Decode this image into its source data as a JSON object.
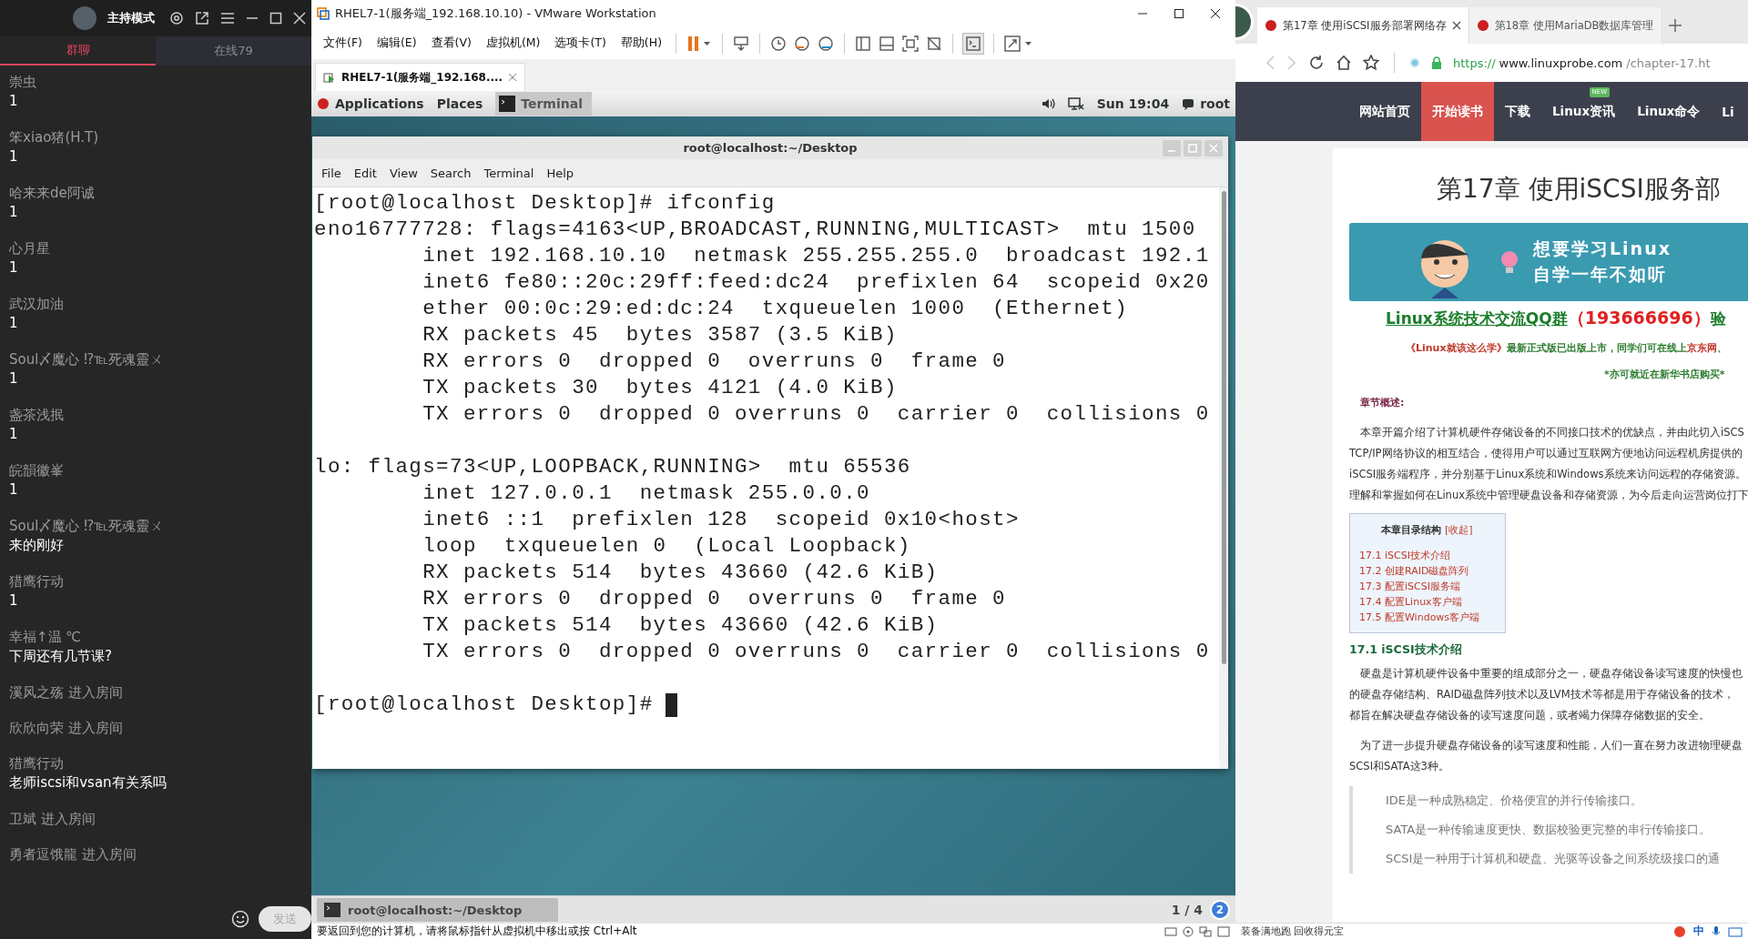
{
  "chat_panel": {
    "host_mode": "主持模式",
    "tabs": [
      {
        "label": "群聊",
        "selected": true
      },
      {
        "label": "在线79",
        "selected": false
      }
    ],
    "messages": [
      {
        "kind": "message",
        "sender": "崇虫",
        "text": "1"
      },
      {
        "kind": "message",
        "sender": "笨xiao猪(H.T)",
        "text": "1"
      },
      {
        "kind": "message",
        "sender": "哈来来de阿诚",
        "text": "1"
      },
      {
        "kind": "message",
        "sender": "心月星",
        "text": "1"
      },
      {
        "kind": "message",
        "sender": "武汉加油",
        "text": "1"
      },
      {
        "kind": "message",
        "sender": "Soul〆魔心 ⁉℡死魂靈ㄨ",
        "text": "1"
      },
      {
        "kind": "message",
        "sender": "盏茶浅抿",
        "text": "1"
      },
      {
        "kind": "message",
        "sender": "皖韻徽峯",
        "text": "1"
      },
      {
        "kind": "message",
        "sender": "Soul〆魔心 ⁉℡死魂靈ㄨ",
        "text": "来的刚好"
      },
      {
        "kind": "message",
        "sender": "猎鹰行动",
        "text": "1"
      },
      {
        "kind": "message",
        "sender": "幸福↑温 ℃",
        "text": "下周还有几节课?"
      },
      {
        "kind": "join",
        "text": "溪风之殇 进入房间"
      },
      {
        "kind": "join",
        "text": "欣欣向荣 进入房间"
      },
      {
        "kind": "message",
        "sender": "猎鹰行动",
        "text": "老师iscsi和vsan有关系吗"
      },
      {
        "kind": "join",
        "text": "卫斌 进入房间"
      },
      {
        "kind": "join",
        "text": "勇者逗饿龍 进入房间"
      }
    ],
    "send_button": "发送"
  },
  "vmware": {
    "title": "RHEL7-1(服务端_192.168.10.10) - VMware Workstation",
    "menu": [
      "文件(F)",
      "编辑(E)",
      "查看(V)",
      "虚拟机(M)",
      "选项卡(T)",
      "帮助(H)"
    ],
    "vm_tab": "RHEL7-1(服务端_192.168....",
    "gnome_bar": {
      "applications": "Applications",
      "places": "Places",
      "active_app": "Terminal",
      "clock": "Sun 19:04",
      "user": "root"
    },
    "terminal": {
      "title": "root@localhost:~/Desktop",
      "menu": [
        "File",
        "Edit",
        "View",
        "Search",
        "Terminal",
        "Help"
      ],
      "blocks": [
        [
          "[root@localhost Desktop]# ifconfig",
          "eno16777728: flags=4163<UP,BROADCAST,RUNNING,MULTICAST>  mtu 1500",
          "        inet 192.168.10.10  netmask 255.255.255.0  broadcast 192.1",
          "        inet6 fe80::20c:29ff:feed:dc24  prefixlen 64  scopeid 0x20",
          "        ether 00:0c:29:ed:dc:24  txqueuelen 1000  (Ethernet)",
          "        RX packets 45  bytes 3587 (3.5 KiB)",
          "        RX errors 0  dropped 0  overruns 0  frame 0",
          "        TX packets 30  bytes 4121 (4.0 KiB)",
          "        TX errors 0  dropped 0 overruns 0  carrier 0  collisions 0"
        ],
        [
          "lo: flags=73<UP,LOOPBACK,RUNNING>  mtu 65536",
          "        inet 127.0.0.1  netmask 255.0.0.0",
          "        inet6 ::1  prefixlen 128  scopeid 0x10<host>",
          "        loop  txqueuelen 0  (Local Loopback)",
          "        RX packets 514  bytes 43660 (42.6 KiB)",
          "        RX errors 0  dropped 0  overruns 0  frame 0",
          "        TX packets 514  bytes 43660 (42.6 KiB)",
          "        TX errors 0  dropped 0 overruns 0  carrier 0  collisions 0"
        ]
      ],
      "prompt": "[root@localhost Desktop]#"
    },
    "taskbar": {
      "window": "root@localhost:~/Desktop",
      "workspace": "1 / 4",
      "notifications": "2"
    },
    "status_bar": "要返回到您的计算机，请将鼠标指针从虚拟机中移出或按 Ctrl+Alt"
  },
  "browser": {
    "tabs": [
      {
        "title": "第17章 使用iSCSI服务部署网络存",
        "selected": true
      },
      {
        "title": "第18章 使用MariaDB数据库管理",
        "selected": false
      }
    ],
    "url": {
      "scheme": "https://",
      "host": "www.linuxprobe.com",
      "path": "/chapter-17.ht"
    },
    "nav": [
      {
        "label": "网站首页",
        "selected": false
      },
      {
        "label": "开始读书",
        "selected": true
      },
      {
        "label": "下载",
        "selected": false
      },
      {
        "label": "Linux资讯",
        "selected": false,
        "badge": "NEW"
      },
      {
        "label": "Linux命令",
        "selected": false
      },
      {
        "label": "Li",
        "selected": false
      }
    ],
    "article": {
      "title": "第17章 使用iSCSI服务部",
      "banner": [
        "想要学习Linux",
        "自学一年不如听"
      ],
      "qq_group": {
        "label": "Linux系统技术交流QQ群",
        "number": "（193666696）",
        "tail": "验"
      },
      "book_notice": [
        {
          "text": "《Linux就该这么学》",
          "kind": "highlight"
        },
        {
          "text": "最新正式版已出版上市，同学们可在线上",
          "kind": "plain"
        },
        {
          "text": "京东网",
          "kind": "highlight"
        },
        {
          "text": "、",
          "kind": "plain"
        }
      ],
      "bookstore_notice": "*亦可就近在新华书店购买*",
      "summary_label": "章节概述:",
      "summary_lines": [
        "本章开篇介绍了计算机硬件存储设备的不同接口技术的优缺点，并由此切入iSCS",
        "TCP/IP网络协议的相互结合，使得用户可以通过互联网方便地访问远程机房提供的",
        "iSCSI服务端程序，并分别基于Linux系统和Windows系统来访问远程的存储资源。",
        "理解和掌握如何在Linux系统中管理硬盘设备和存储资源，为今后走向运营岗位打下"
      ],
      "toc": {
        "title": "本章目录结构",
        "toggle": "[收起]",
        "items": [
          "17.1 iSCSI技术介绍",
          "17.2 创建RAID磁盘阵列",
          "17.3 配置iSCSI服务端",
          "17.4 配置Linux客户端",
          "17.5 配置Windows客户端"
        ]
      },
      "section_title": "17.1 iSCSI技术介绍",
      "paragraphs": [
        [
          "硬盘是计算机硬件设备中重要的组成部分之一，硬盘存储设备读写速度的快慢也",
          "的硬盘存储结构、RAID磁盘阵列技术以及LVM技术等都是用于存储设备的技术，",
          "都旨在解决硬盘存储设备的读写速度问题，或者竭力保障存储数据的安全。"
        ],
        [
          "为了进一步提升硬盘存储设备的读写速度和性能，人们一直在努力改进物理硬盘",
          "SCSI和SATA这3种。"
        ]
      ],
      "quote_lines": [
        "IDE是一种成熟稳定、价格便宜的并行传输接口。",
        "SATA是一种传输速度更快、数据校验更完整的串行传输接口。",
        "SCSI是一种用于计算机和硬盘、光驱等设备之间系统级接口的通"
      ]
    },
    "bottom_bar": {
      "ad_text": "装备满地跑 回收得元宝",
      "ime": "中"
    }
  }
}
